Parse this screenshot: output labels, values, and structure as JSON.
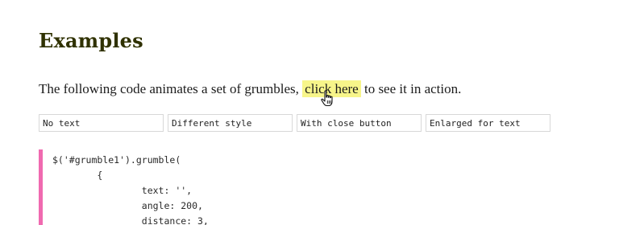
{
  "heading": "Examples",
  "intro": {
    "before": "The following code animates a set of grumbles, ",
    "link": "click here",
    "after": " to see it in action."
  },
  "inputs": [
    "No text",
    "Different style",
    "With close button",
    "Enlarged for text"
  ],
  "code_lines": [
    "$('#grumble1').grumble(",
    "        {",
    "                text: '',",
    "                angle: 200,",
    "                distance: 3,"
  ],
  "colors": {
    "heading": "#2f3100",
    "link_highlight": "#f7f58a",
    "code_bar": "#f06ab0"
  },
  "icons": {
    "cursor": "hand-pointer-icon"
  }
}
